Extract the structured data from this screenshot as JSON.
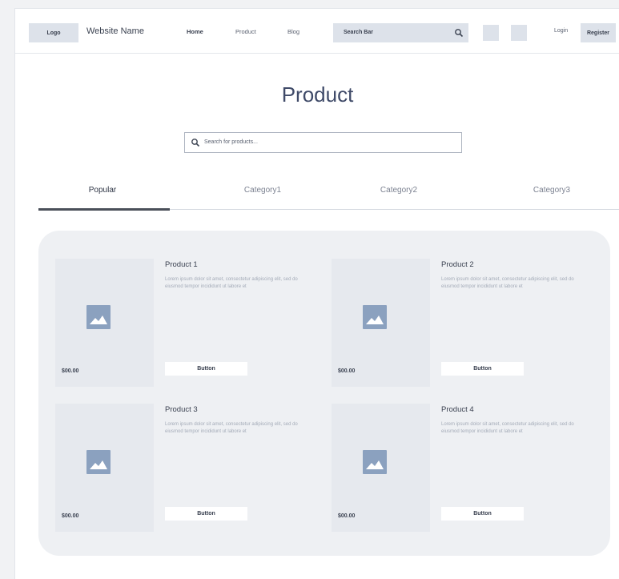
{
  "header": {
    "logo": "Logo",
    "site_name": "Website Name",
    "nav": [
      "Home",
      "Product",
      "Blog"
    ],
    "search_placeholder": "Search Bar",
    "login": "Login",
    "register": "Register"
  },
  "main": {
    "title": "Product",
    "search_placeholder": "Search for products...",
    "tabs": [
      "Popular",
      "Category1",
      "Category2",
      "Category3"
    ],
    "active_tab": "Popular"
  },
  "products": [
    {
      "name": "Product 1",
      "description": "Lorem ipsum dolor sit amet, consectetur adipiscing elit, sed do eiusmod tempor incididunt ut labore et",
      "price": "$00.00",
      "button": "Button"
    },
    {
      "name": "Product 2",
      "description": "Lorem ipsum dolor sit amet, consectetur adipiscing elit, sed do eiusmod tempor incididunt ut labore et",
      "price": "$00.00",
      "button": "Button"
    },
    {
      "name": "Product 3",
      "description": "Lorem ipsum dolor sit amet, consectetur adipiscing elit, sed do eiusmod tempor incididunt ut labore et",
      "price": "$00.00",
      "button": "Button"
    },
    {
      "name": "Product 4",
      "description": "Lorem ipsum dolor sit amet, consectetur adipiscing elit, sed do eiusmod tempor incididunt ut labore et",
      "price": "$00.00",
      "button": "Button"
    }
  ],
  "icons": {
    "search": "search-icon",
    "image_placeholder": "image-placeholder-icon"
  },
  "colors": {
    "accent_placeholder": "#8ba1bf",
    "panel_bg": "#eef0f3",
    "title": "#3f4a68"
  }
}
